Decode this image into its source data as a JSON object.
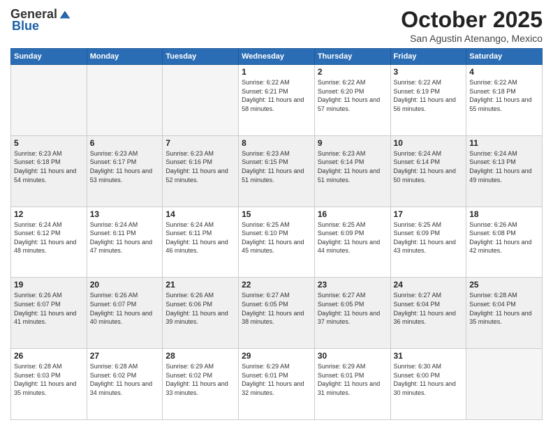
{
  "header": {
    "logo_general": "General",
    "logo_blue": "Blue",
    "month": "October 2025",
    "location": "San Agustin Atenango, Mexico"
  },
  "weekdays": [
    "Sunday",
    "Monday",
    "Tuesday",
    "Wednesday",
    "Thursday",
    "Friday",
    "Saturday"
  ],
  "weeks": [
    [
      {
        "day": "",
        "sunrise": "",
        "sunset": "",
        "daylight": "",
        "empty": true
      },
      {
        "day": "",
        "sunrise": "",
        "sunset": "",
        "daylight": "",
        "empty": true
      },
      {
        "day": "",
        "sunrise": "",
        "sunset": "",
        "daylight": "",
        "empty": true
      },
      {
        "day": "1",
        "sunrise": "Sunrise: 6:22 AM",
        "sunset": "Sunset: 6:21 PM",
        "daylight": "Daylight: 11 hours and 58 minutes."
      },
      {
        "day": "2",
        "sunrise": "Sunrise: 6:22 AM",
        "sunset": "Sunset: 6:20 PM",
        "daylight": "Daylight: 11 hours and 57 minutes."
      },
      {
        "day": "3",
        "sunrise": "Sunrise: 6:22 AM",
        "sunset": "Sunset: 6:19 PM",
        "daylight": "Daylight: 11 hours and 56 minutes."
      },
      {
        "day": "4",
        "sunrise": "Sunrise: 6:22 AM",
        "sunset": "Sunset: 6:18 PM",
        "daylight": "Daylight: 11 hours and 55 minutes."
      }
    ],
    [
      {
        "day": "5",
        "sunrise": "Sunrise: 6:23 AM",
        "sunset": "Sunset: 6:18 PM",
        "daylight": "Daylight: 11 hours and 54 minutes."
      },
      {
        "day": "6",
        "sunrise": "Sunrise: 6:23 AM",
        "sunset": "Sunset: 6:17 PM",
        "daylight": "Daylight: 11 hours and 53 minutes."
      },
      {
        "day": "7",
        "sunrise": "Sunrise: 6:23 AM",
        "sunset": "Sunset: 6:16 PM",
        "daylight": "Daylight: 11 hours and 52 minutes."
      },
      {
        "day": "8",
        "sunrise": "Sunrise: 6:23 AM",
        "sunset": "Sunset: 6:15 PM",
        "daylight": "Daylight: 11 hours and 51 minutes."
      },
      {
        "day": "9",
        "sunrise": "Sunrise: 6:23 AM",
        "sunset": "Sunset: 6:14 PM",
        "daylight": "Daylight: 11 hours and 51 minutes."
      },
      {
        "day": "10",
        "sunrise": "Sunrise: 6:24 AM",
        "sunset": "Sunset: 6:14 PM",
        "daylight": "Daylight: 11 hours and 50 minutes."
      },
      {
        "day": "11",
        "sunrise": "Sunrise: 6:24 AM",
        "sunset": "Sunset: 6:13 PM",
        "daylight": "Daylight: 11 hours and 49 minutes."
      }
    ],
    [
      {
        "day": "12",
        "sunrise": "Sunrise: 6:24 AM",
        "sunset": "Sunset: 6:12 PM",
        "daylight": "Daylight: 11 hours and 48 minutes."
      },
      {
        "day": "13",
        "sunrise": "Sunrise: 6:24 AM",
        "sunset": "Sunset: 6:11 PM",
        "daylight": "Daylight: 11 hours and 47 minutes."
      },
      {
        "day": "14",
        "sunrise": "Sunrise: 6:24 AM",
        "sunset": "Sunset: 6:11 PM",
        "daylight": "Daylight: 11 hours and 46 minutes."
      },
      {
        "day": "15",
        "sunrise": "Sunrise: 6:25 AM",
        "sunset": "Sunset: 6:10 PM",
        "daylight": "Daylight: 11 hours and 45 minutes."
      },
      {
        "day": "16",
        "sunrise": "Sunrise: 6:25 AM",
        "sunset": "Sunset: 6:09 PM",
        "daylight": "Daylight: 11 hours and 44 minutes."
      },
      {
        "day": "17",
        "sunrise": "Sunrise: 6:25 AM",
        "sunset": "Sunset: 6:09 PM",
        "daylight": "Daylight: 11 hours and 43 minutes."
      },
      {
        "day": "18",
        "sunrise": "Sunrise: 6:26 AM",
        "sunset": "Sunset: 6:08 PM",
        "daylight": "Daylight: 11 hours and 42 minutes."
      }
    ],
    [
      {
        "day": "19",
        "sunrise": "Sunrise: 6:26 AM",
        "sunset": "Sunset: 6:07 PM",
        "daylight": "Daylight: 11 hours and 41 minutes."
      },
      {
        "day": "20",
        "sunrise": "Sunrise: 6:26 AM",
        "sunset": "Sunset: 6:07 PM",
        "daylight": "Daylight: 11 hours and 40 minutes."
      },
      {
        "day": "21",
        "sunrise": "Sunrise: 6:26 AM",
        "sunset": "Sunset: 6:06 PM",
        "daylight": "Daylight: 11 hours and 39 minutes."
      },
      {
        "day": "22",
        "sunrise": "Sunrise: 6:27 AM",
        "sunset": "Sunset: 6:05 PM",
        "daylight": "Daylight: 11 hours and 38 minutes."
      },
      {
        "day": "23",
        "sunrise": "Sunrise: 6:27 AM",
        "sunset": "Sunset: 6:05 PM",
        "daylight": "Daylight: 11 hours and 37 minutes."
      },
      {
        "day": "24",
        "sunrise": "Sunrise: 6:27 AM",
        "sunset": "Sunset: 6:04 PM",
        "daylight": "Daylight: 11 hours and 36 minutes."
      },
      {
        "day": "25",
        "sunrise": "Sunrise: 6:28 AM",
        "sunset": "Sunset: 6:04 PM",
        "daylight": "Daylight: 11 hours and 35 minutes."
      }
    ],
    [
      {
        "day": "26",
        "sunrise": "Sunrise: 6:28 AM",
        "sunset": "Sunset: 6:03 PM",
        "daylight": "Daylight: 11 hours and 35 minutes."
      },
      {
        "day": "27",
        "sunrise": "Sunrise: 6:28 AM",
        "sunset": "Sunset: 6:02 PM",
        "daylight": "Daylight: 11 hours and 34 minutes."
      },
      {
        "day": "28",
        "sunrise": "Sunrise: 6:29 AM",
        "sunset": "Sunset: 6:02 PM",
        "daylight": "Daylight: 11 hours and 33 minutes."
      },
      {
        "day": "29",
        "sunrise": "Sunrise: 6:29 AM",
        "sunset": "Sunset: 6:01 PM",
        "daylight": "Daylight: 11 hours and 32 minutes."
      },
      {
        "day": "30",
        "sunrise": "Sunrise: 6:29 AM",
        "sunset": "Sunset: 6:01 PM",
        "daylight": "Daylight: 11 hours and 31 minutes."
      },
      {
        "day": "31",
        "sunrise": "Sunrise: 6:30 AM",
        "sunset": "Sunset: 6:00 PM",
        "daylight": "Daylight: 11 hours and 30 minutes."
      },
      {
        "day": "",
        "sunrise": "",
        "sunset": "",
        "daylight": "",
        "empty": true
      }
    ]
  ]
}
